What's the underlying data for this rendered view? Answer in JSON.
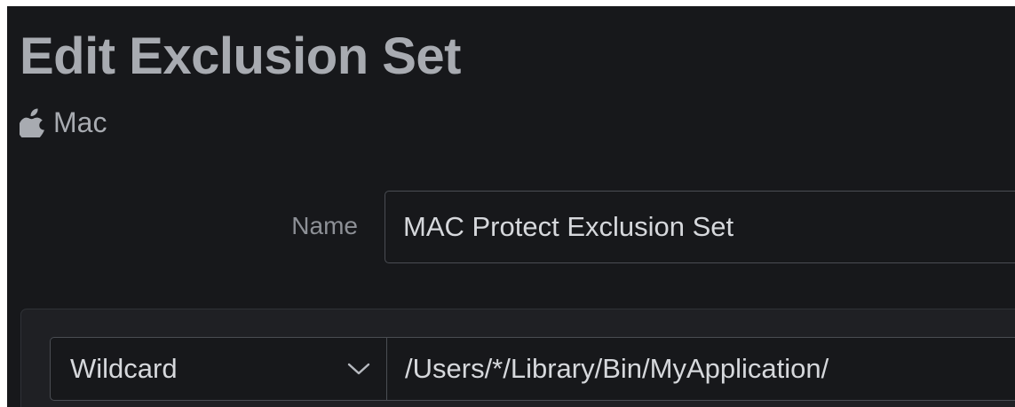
{
  "page": {
    "title": "Edit Exclusion Set",
    "platform": {
      "icon": "apple-icon",
      "label": "Mac"
    }
  },
  "form": {
    "name_label": "Name",
    "name_value": "MAC Protect Exclusion Set"
  },
  "exclusion_rule": {
    "type_value": "Wildcard",
    "path_value": "/Users/*/Library/Bin/MyApplication/"
  },
  "colors": {
    "background": "#17181b",
    "panel": "#1f2024",
    "border": "#4a4d53",
    "title_text": "#a8abb1",
    "input_text": "#d6d8dc"
  }
}
